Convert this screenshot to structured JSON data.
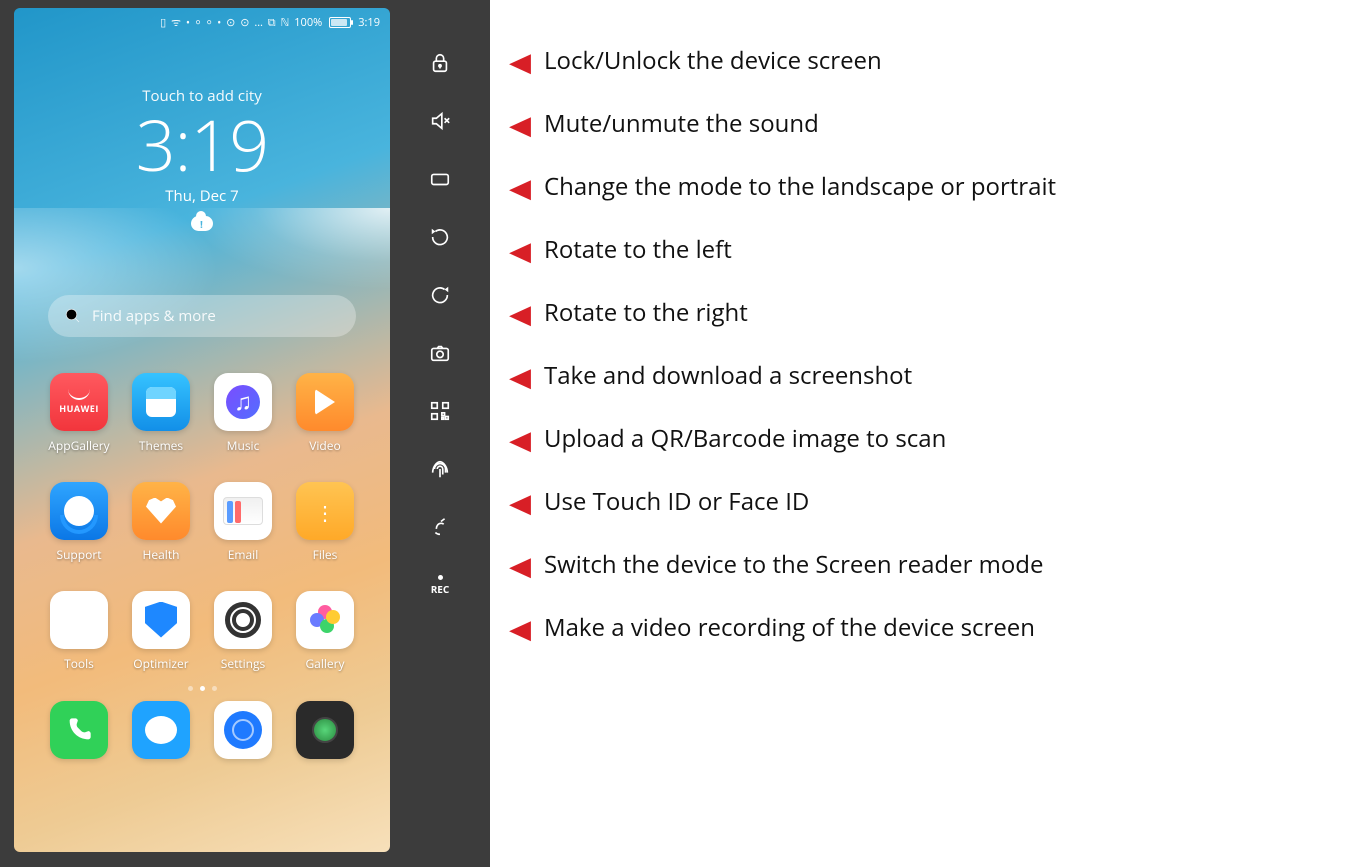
{
  "status": {
    "glyphs": "▯ ᯤ • ⸰ ⸰ • ⊙ ⊙ … ⧉ ℕ",
    "battery_pct": "100%",
    "clock": "3:19"
  },
  "widget": {
    "touch": "Touch to add city",
    "time": "3:19",
    "date": "Thu, Dec 7"
  },
  "search": {
    "placeholder": "Find apps & more"
  },
  "apps": {
    "r1": [
      {
        "label": "AppGallery"
      },
      {
        "label": "Themes"
      },
      {
        "label": "Music"
      },
      {
        "label": "Video"
      }
    ],
    "r2": [
      {
        "label": "Support"
      },
      {
        "label": "Health"
      },
      {
        "label": "Email"
      },
      {
        "label": "Files"
      }
    ],
    "r3": [
      {
        "label": "Tools"
      },
      {
        "label": "Optimizer"
      },
      {
        "label": "Settings"
      },
      {
        "label": "Gallery"
      }
    ]
  },
  "toolbar": {
    "items": [
      {
        "name": "lock",
        "desc": "Lock/Unlock the device screen"
      },
      {
        "name": "mute",
        "desc": "Mute/unmute the sound"
      },
      {
        "name": "orientation",
        "desc": "Change the mode to the landscape or portrait"
      },
      {
        "name": "rotate-left",
        "desc": "Rotate to the left"
      },
      {
        "name": "rotate-right",
        "desc": "Rotate to the right"
      },
      {
        "name": "screenshot",
        "desc": "Take and download a screenshot"
      },
      {
        "name": "qr",
        "desc": "Upload a QR/Barcode image to scan"
      },
      {
        "name": "biometric",
        "desc": "Use Touch ID or Face ID"
      },
      {
        "name": "screen-reader",
        "desc": "Switch the device to the Screen reader mode"
      },
      {
        "name": "record",
        "desc": "Make a video recording of the device screen"
      }
    ],
    "rec_label": "REC"
  }
}
